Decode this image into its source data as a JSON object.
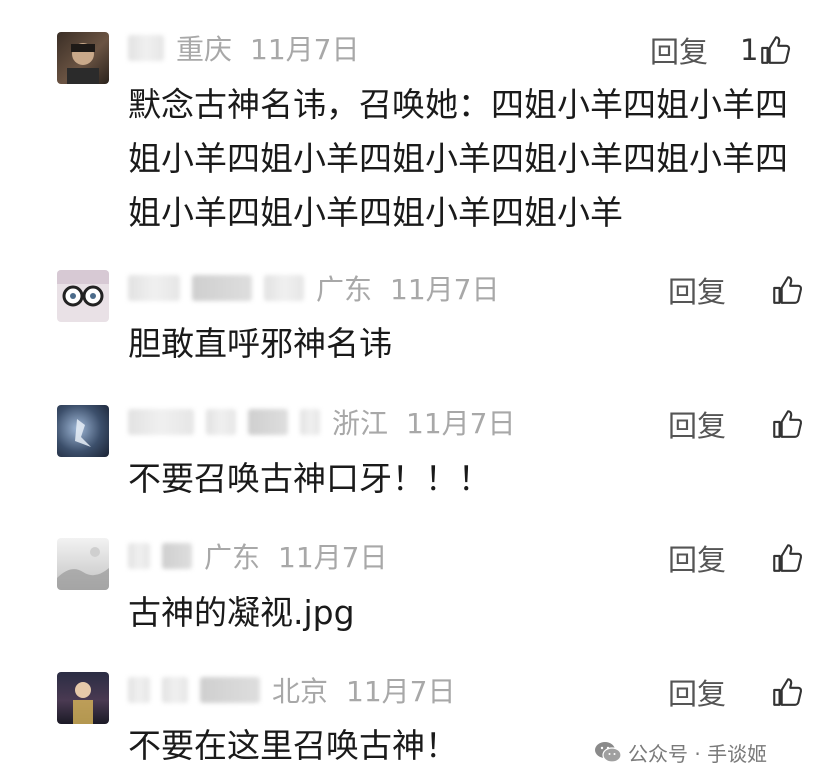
{
  "comments": [
    {
      "region": "重庆",
      "date": "11月7日",
      "reply_label": "回复",
      "like_count": "1",
      "text": "默念古神名讳，召唤她：四姐小羊四姐小羊四姐小羊四姐小羊四姐小羊四姐小羊四姐小羊四姐小羊四姐小羊四姐小羊四姐小羊"
    },
    {
      "region": "广东",
      "date": "11月7日",
      "reply_label": "回复",
      "like_count": "",
      "text": "胆敢直呼邪神名讳"
    },
    {
      "region": "浙江",
      "date": "11月7日",
      "reply_label": "回复",
      "like_count": "",
      "text": "不要召唤古神口牙！！！"
    },
    {
      "region": "广东",
      "date": "11月7日",
      "reply_label": "回复",
      "like_count": "",
      "text": "古神的凝视.jpg"
    },
    {
      "region": "北京",
      "date": "11月7日",
      "reply_label": "回复",
      "like_count": "",
      "text": "不要在这里召唤古神！"
    }
  ],
  "icons": {
    "like": "thumbs-up-icon",
    "wechat": "wechat-icon"
  },
  "watermark": "公众号 · 手谈姬",
  "colors": {
    "meta": "#a8a8a8",
    "text": "#1a1a1a",
    "reply": "#555555"
  }
}
